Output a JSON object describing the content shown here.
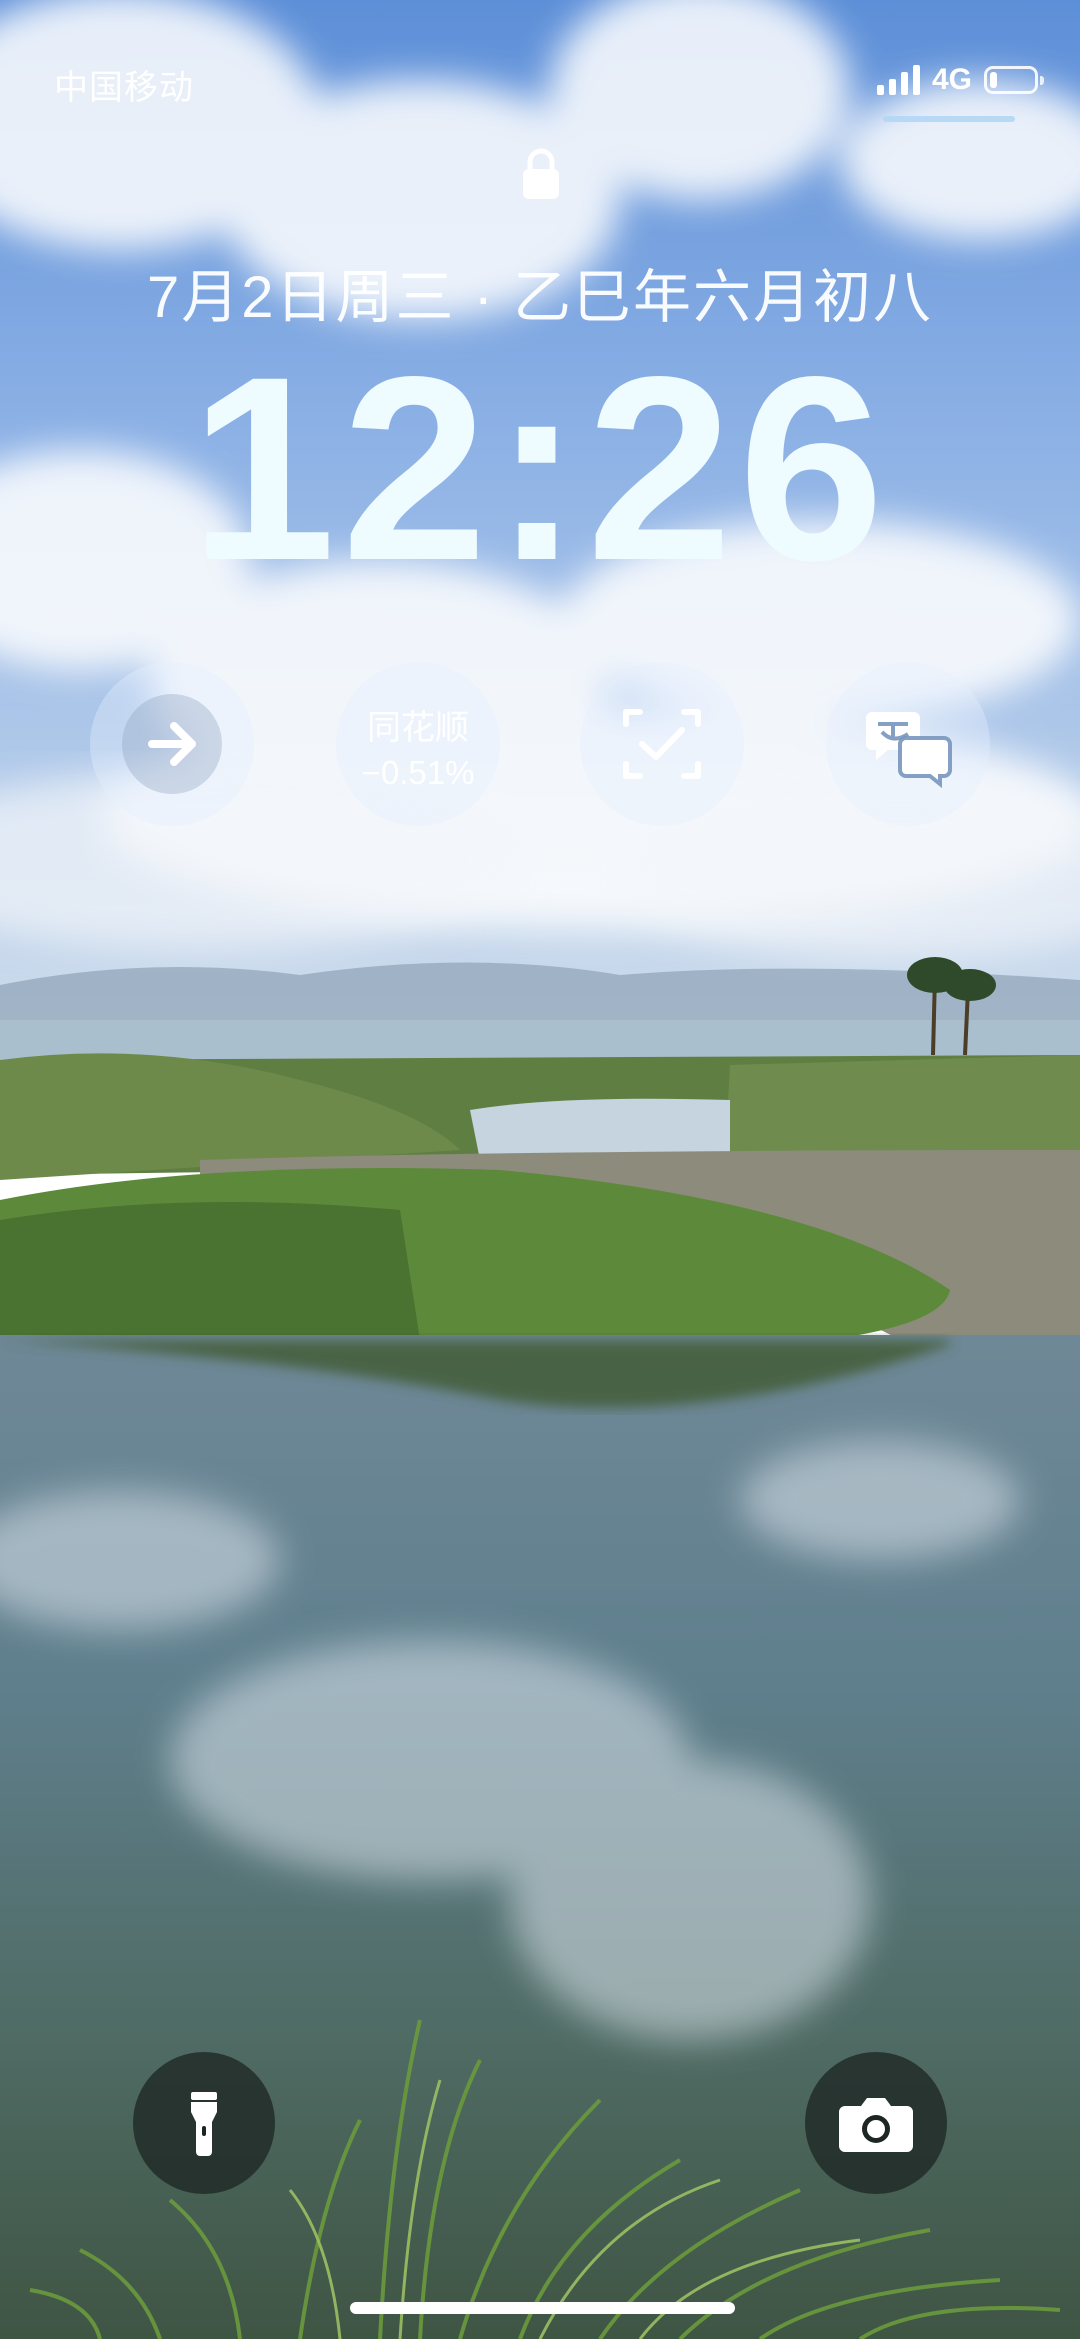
{
  "status_bar": {
    "carrier": "中国移动",
    "network": "4G",
    "signal_bars": 4,
    "battery_level": 0.12
  },
  "lock_screen": {
    "date": "7月2日周三 · 乙巳年六月初八",
    "time": "12:26"
  },
  "widgets": [
    {
      "icon": "arrow-right-icon"
    },
    {
      "title": "同花顺",
      "change": "−0.51%"
    },
    {
      "icon": "scan-check-icon"
    },
    {
      "icon": "translate-icon"
    }
  ],
  "quick_actions": {
    "left": {
      "icon": "flashlight-icon"
    },
    "right": {
      "icon": "camera-icon"
    }
  },
  "colors": {
    "widget_bg": "#e6f0ff",
    "quick_action_bg": "#1e2624",
    "clock": "#eefbff"
  }
}
